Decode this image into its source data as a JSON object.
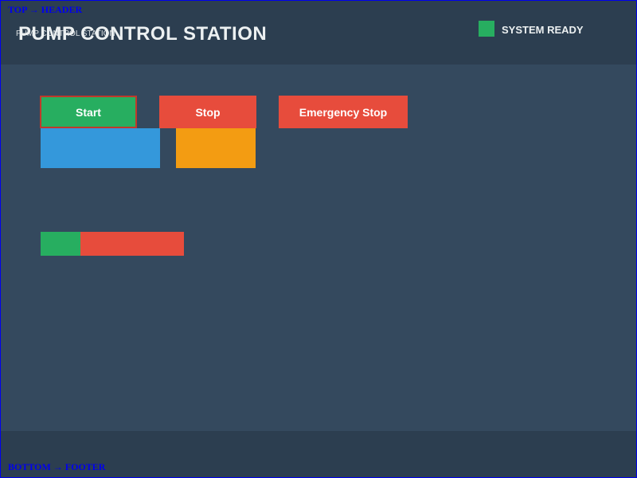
{
  "annotations": {
    "top_label": "TOP → HEADER",
    "bottom_label": "BOTTOM → FOOTER"
  },
  "header": {
    "title": "PUMP CONTROL STATION",
    "title_overlay": "PUMP CONTROL STATION",
    "status_label": "SYSTEM READY",
    "status_color": "#27ae60"
  },
  "controls": {
    "start_label": "Start",
    "stop_label": "Stop",
    "emergency_label": "Emergency Stop",
    "start_color": "#27ae60",
    "stop_color": "#e74c3c",
    "emergency_color": "#e74c3c"
  },
  "indicators": {
    "blue_color": "#3498db",
    "orange_color": "#f39c12"
  },
  "level_bar": {
    "fill_fraction": 0.278,
    "fill_color": "#27ae60",
    "track_color": "#e74c3c"
  }
}
